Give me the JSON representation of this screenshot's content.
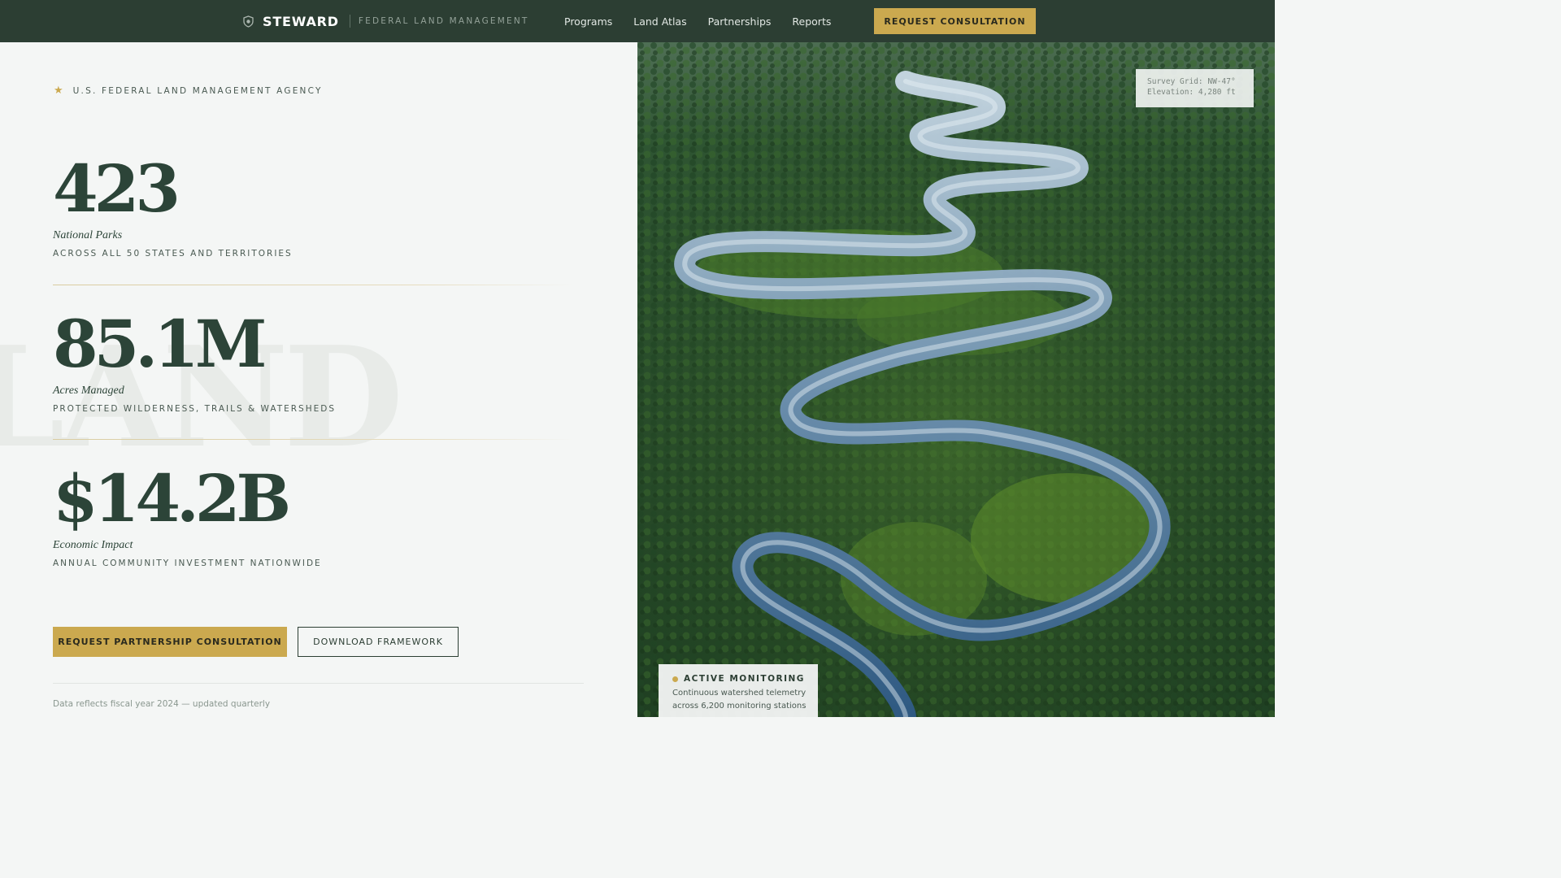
{
  "header": {
    "brand_name": "STEWARD",
    "brand_subtitle": "FEDERAL LAND MANAGEMENT",
    "brand_icon": "shield-icon",
    "nav": [
      {
        "label": "Programs"
      },
      {
        "label": "Land Atlas"
      },
      {
        "label": "Partnerships"
      },
      {
        "label": "Reports"
      }
    ],
    "cta_label": "REQUEST CONSULTATION"
  },
  "hero": {
    "agency_label": "U.S. FEDERAL LAND MANAGEMENT AGENCY",
    "agency_icon": "star-icon",
    "watermark": "LAND",
    "stats": [
      {
        "value": "423",
        "label": "National Parks",
        "description": "ACROSS ALL 50 STATES AND TERRITORIES"
      },
      {
        "value": "85.1M",
        "label": "Acres Managed",
        "description": "PROTECTED WILDERNESS, TRAILS & WATERSHEDS"
      },
      {
        "value": "$14.2B",
        "label": "Economic Impact",
        "description": "ANNUAL COMMUNITY INVESTMENT NATIONWIDE"
      }
    ],
    "primary_button": "REQUEST PARTNERSHIP CONSULTATION",
    "secondary_button": "DOWNLOAD FRAMEWORK",
    "footnote": "Data reflects fiscal year 2024 — updated quarterly"
  },
  "image_panel": {
    "survey_grid": "Survey Grid: NW-47°",
    "elevation": "Elevation: 4,280 ft",
    "monitor_title": "ACTIVE MONITORING",
    "monitor_line1": "Continuous watershed telemetry",
    "monitor_line2": "across 6,200 monitoring stations"
  },
  "colors": {
    "header_bg": "#2c3e33",
    "accent_gold": "#cba94f",
    "stat_green": "#2c4438",
    "page_bg": "#f4f6f5"
  }
}
